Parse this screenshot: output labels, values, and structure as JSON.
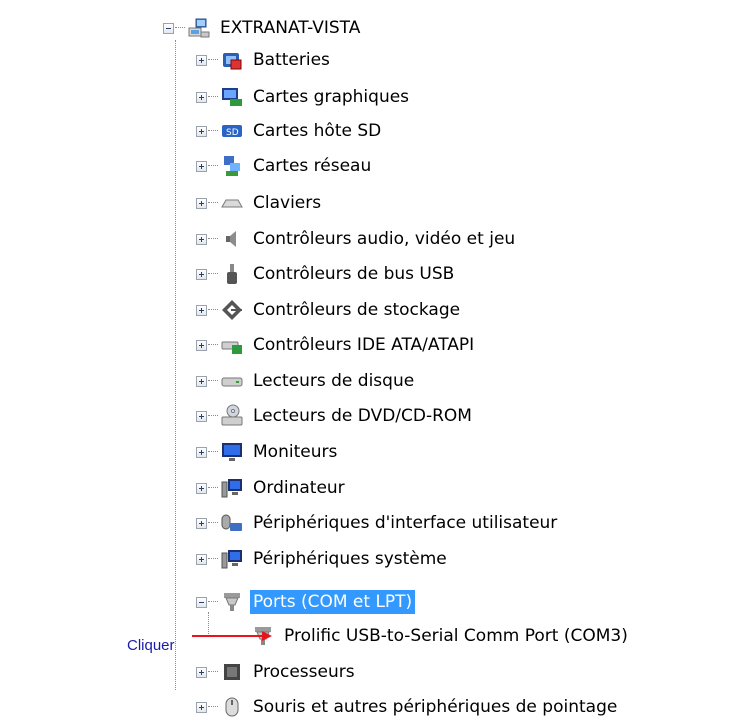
{
  "root": {
    "label": "EXTRANAT-VISTA",
    "icon": "computer-network-icon"
  },
  "categories": [
    {
      "label": "Batteries",
      "icon": "battery-icon"
    },
    {
      "label": "Cartes graphiques",
      "icon": "display-adapter-icon"
    },
    {
      "label": "Cartes hôte SD",
      "icon": "sd-host-icon"
    },
    {
      "label": "Cartes réseau",
      "icon": "network-adapter-icon"
    },
    {
      "label": "Claviers",
      "icon": "keyboard-icon"
    },
    {
      "label": "Contrôleurs audio, vidéo et jeu",
      "icon": "speaker-icon"
    },
    {
      "label": "Contrôleurs de bus USB",
      "icon": "usb-plug-icon"
    },
    {
      "label": "Contrôleurs de stockage",
      "icon": "storage-controller-icon"
    },
    {
      "label": "Contrôleurs IDE ATA/ATAPI",
      "icon": "ide-controller-icon"
    },
    {
      "label": "Lecteurs de disque",
      "icon": "disk-drive-icon"
    },
    {
      "label": "Lecteurs de DVD/CD-ROM",
      "icon": "dvd-drive-icon"
    },
    {
      "label": "Moniteurs",
      "icon": "monitor-icon"
    },
    {
      "label": "Ordinateur",
      "icon": "computer-icon"
    },
    {
      "label": "Périphériques d'interface utilisateur",
      "icon": "hid-icon"
    },
    {
      "label": "Périphériques système",
      "icon": "system-device-icon"
    },
    {
      "label": "Ports (COM et LPT)",
      "icon": "port-icon",
      "expanded": true,
      "selected": true
    },
    {
      "label": "Processeurs",
      "icon": "processor-icon"
    },
    {
      "label": "Souris et autres périphériques de pointage",
      "icon": "mouse-icon"
    }
  ],
  "ports_child": {
    "label": "Prolific USB-to-Serial Comm Port (COM3)",
    "icon": "serial-port-icon"
  },
  "annotation": {
    "text": "Cliquer",
    "arrow_color": "#e8141c",
    "text_color": "#1a1aaa"
  },
  "colors": {
    "selection": "#3399ff"
  }
}
